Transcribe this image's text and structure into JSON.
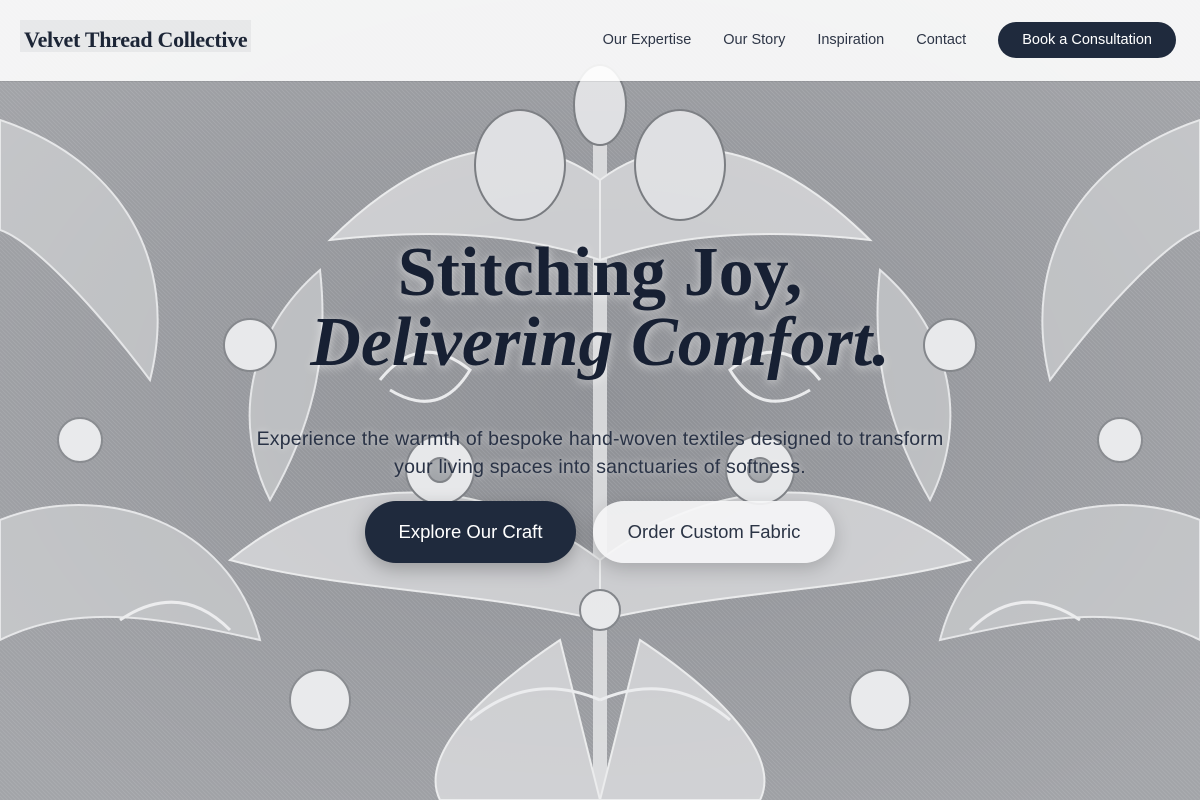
{
  "brand": {
    "name": "Velvet Thread Collective"
  },
  "nav": {
    "items": [
      {
        "label": "Our Expertise"
      },
      {
        "label": "Our Story"
      },
      {
        "label": "Inspiration"
      },
      {
        "label": "Contact"
      }
    ],
    "cta_label": "Book a Consultation"
  },
  "hero": {
    "headline_line1": "Stitching Joy,",
    "headline_line2": "Delivering Comfort.",
    "subtitle": "Experience the warmth of bespoke hand-woven textiles designed to transform your living spaces into sanctuaries of softness.",
    "primary_button": "Explore Our Craft",
    "secondary_button": "Order Custom Fabric"
  },
  "colors": {
    "brand_dark": "#1f2a3d",
    "text_dark": "#172033",
    "header_bg": "#ffffff",
    "secondary_button_bg": "#f5f5f6"
  },
  "background": {
    "image": "grey damask floral woven fabric"
  }
}
